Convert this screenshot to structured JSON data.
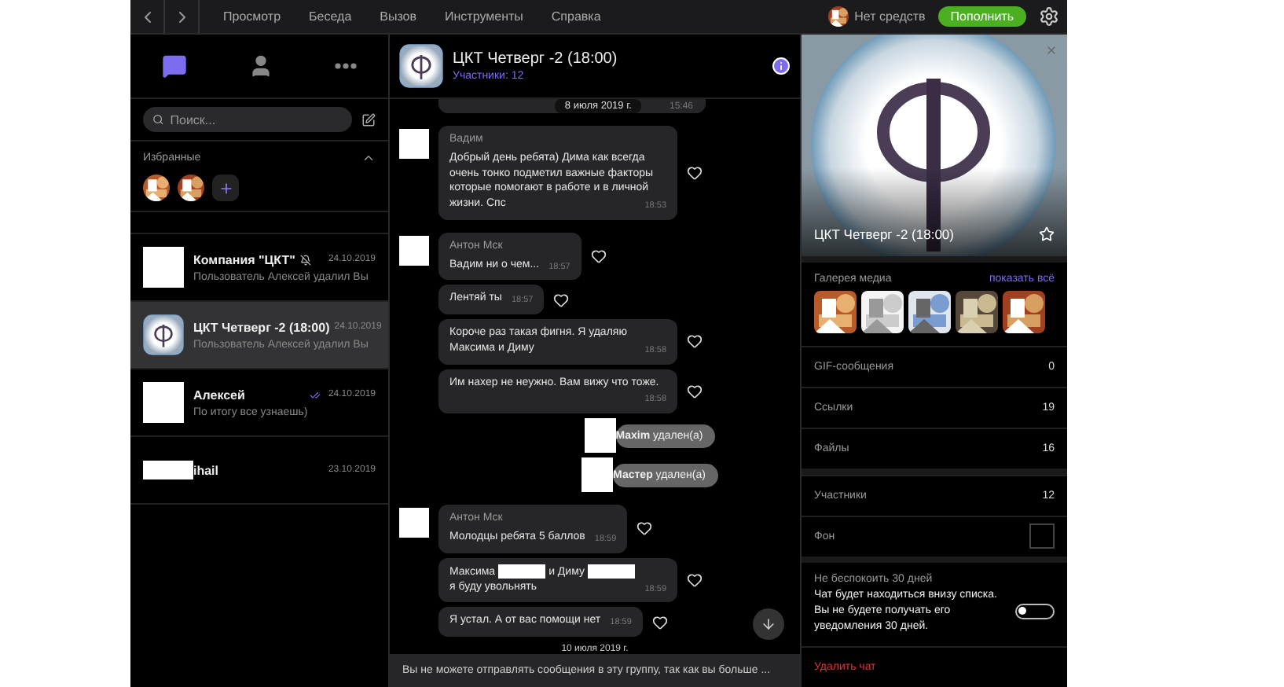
{
  "menu": [
    "Просмотр",
    "Беседа",
    "Вызов",
    "Инструменты",
    "Справка"
  ],
  "account": {
    "balance": "Нет средств",
    "topup": "Пополнить"
  },
  "sidebar": {
    "tabs": [
      {
        "kind": "chats",
        "selected": true
      },
      {
        "kind": "contacts",
        "selected": false
      },
      {
        "kind": "more",
        "selected": false
      }
    ],
    "search": {
      "placeholder": "Поиск..."
    },
    "favorites": {
      "title": "Избранные",
      "expanded": true
    },
    "chats": [
      {
        "name": "Компания \"ЦКТ\"",
        "muted": true,
        "read": false,
        "date": "24.10.2019",
        "preview": "Пользователь Алексей удалил Вы",
        "logo": false,
        "selected": false
      },
      {
        "name": "ЦКТ Четверг -2 (18:00)",
        "muted": false,
        "read": false,
        "date": "24.10.2019",
        "preview": "Пользователь Алексей удалил Вы",
        "logo": true,
        "selected": true
      },
      {
        "name": "Алексей",
        "muted": false,
        "read": true,
        "date": "24.10.2019",
        "preview": "По итогу все узнаешь)",
        "logo": false,
        "selected": false
      },
      {
        "name": "ihail",
        "muted": false,
        "read": false,
        "date": "23.10.2019",
        "name_hidden": true,
        "selected": false
      }
    ]
  },
  "chat": {
    "title": "ЦКТ Четверг -2 (18:00)",
    "members": "Участники: 12",
    "messages": [
      {
        "kind": "date-top",
        "text": "8 июля 2019 г.",
        "time": "15:46"
      },
      {
        "kind": "message",
        "author": "Вадим",
        "parts": [
          "Добрый день ребята) Дима как всегда очень тонко подметил важные факторы которые помогают в работе и в личной жизни. Спс"
        ],
        "time": "18:53"
      },
      {
        "kind": "message",
        "author": "Антон Мск",
        "parts": [
          "Вадим ни о чем..."
        ],
        "time": "18:57"
      },
      {
        "kind": "message",
        "parts": [
          "Лентяй ты"
        ],
        "time": "18:57"
      },
      {
        "kind": "message",
        "parts": [
          "Короче раз такая фигня. Я удаляю Максима и Диму"
        ],
        "time": "18:58"
      },
      {
        "kind": "message",
        "parts": [
          "Им нахер не неужно. Вам вижу что тоже."
        ],
        "time": "18:58"
      },
      {
        "kind": "system",
        "text": "**Maxim** удален(а)"
      },
      {
        "kind": "system",
        "text": "**Мастер** удален(а)"
      },
      {
        "kind": "message",
        "author": "Антон Мск",
        "parts": [
          "Молодцы ребята 5 баллов"
        ],
        "time": "18:59"
      },
      {
        "kind": "message",
        "parts": [
          "Максима",
          "и Диму",
          "я буду увольнять"
        ],
        "time": "18:59"
      },
      {
        "kind": "message",
        "parts": [
          "Я устал. А от вас помощи нет"
        ],
        "time": "18:59"
      },
      {
        "kind": "date",
        "text": "10 июля 2019 г."
      }
    ],
    "notice": "Вы не можете отправлять сообщения в эту группу, так как вы больше ..."
  },
  "info": {
    "title": "ЦКТ Четверг -2 (18:00)",
    "gallery": {
      "title": "Галерея медиа",
      "link": "показать всё"
    },
    "rows": [
      {
        "kind": "count",
        "label": "GIF-сообщения",
        "value": "0"
      },
      {
        "kind": "count",
        "label": "Ссылки",
        "value": "19"
      },
      {
        "kind": "count",
        "label": "Файлы",
        "value": "16"
      },
      {
        "kind": "gap"
      },
      {
        "kind": "count",
        "label": "Участники",
        "value": "12"
      },
      {
        "kind": "swatch",
        "label": "Фон"
      }
    ],
    "mute": {
      "title": "Не беспокоить 30 дней",
      "text": "Чат будет находиться внизу списка. Вы не будете получать его уведомления 30 дней.",
      "on": false
    },
    "delete": "Удалить чат"
  }
}
